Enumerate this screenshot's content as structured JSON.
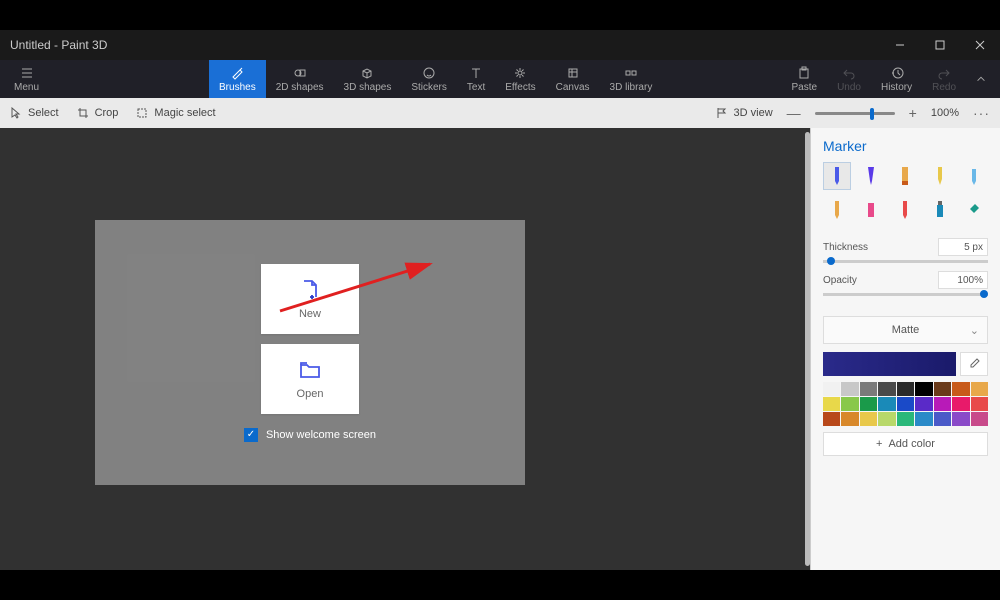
{
  "title": "Untitled - Paint 3D",
  "ribbon": {
    "menu": "Menu",
    "brushes": "Brushes",
    "shapes2d": "2D shapes",
    "shapes3d": "3D shapes",
    "stickers": "Stickers",
    "text": "Text",
    "effects": "Effects",
    "canvas": "Canvas",
    "library3d": "3D library",
    "paste": "Paste",
    "undo": "Undo",
    "history": "History",
    "redo": "Redo"
  },
  "toolbar": {
    "select": "Select",
    "crop": "Crop",
    "magic": "Magic select",
    "view3d": "3D view",
    "zoom": "100%"
  },
  "welcome": {
    "new": "New",
    "open": "Open",
    "show": "Show welcome screen"
  },
  "side": {
    "title": "Marker",
    "thickness_label": "Thickness",
    "thickness_value": "5 px",
    "opacity_label": "Opacity",
    "opacity_value": "100%",
    "matte": "Matte",
    "addcolor": "Add color"
  },
  "palette": [
    "#f1f1f1",
    "#c8c8c8",
    "#7a7a7a",
    "#4a4a4a",
    "#2a2a2a",
    "#000000",
    "#6a3a1a",
    "#c85a1a",
    "#e8a84a",
    "#e8d84a",
    "#88c84a",
    "#1a9a4a",
    "#1a8ab8",
    "#1a4ac8",
    "#5a2ac8",
    "#b81ab8",
    "#e81a6a",
    "#e84a4a",
    "#b8481a",
    "#d8882a",
    "#e8c84a",
    "#b8d86a",
    "#2ab87a",
    "#2a8ac8",
    "#4a5ac8",
    "#8a4ac8",
    "#c84a8a"
  ]
}
